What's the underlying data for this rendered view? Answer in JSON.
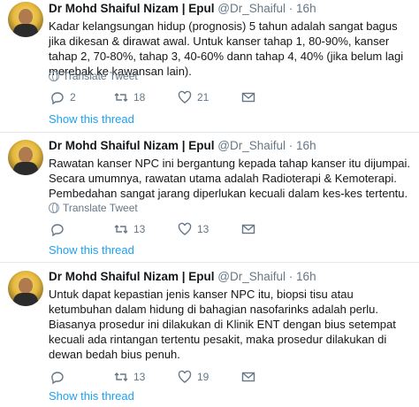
{
  "tweets": [
    {
      "name": "Dr Mohd Shaiful Nizam | Epul",
      "handle": "@Dr_Shaiful",
      "time": "16h",
      "text": "Kadar kelangsungan hidup (prognosis) 5 tahun adalah sangat bagus jika dikesan & dirawat awal. Untuk kanser tahap 1, 80-90%, kanser tahap 2, 70-80%, tahap 3, 40-60% dann tahap 4, 40% (jika belum lagi merebak ke kawansan lain).",
      "translate": "Translate Tweet",
      "replies": "2",
      "retweets": "18",
      "likes": "21",
      "show_thread": "Show this thread"
    },
    {
      "name": "Dr Mohd Shaiful Nizam | Epul",
      "handle": "@Dr_Shaiful",
      "time": "16h",
      "text": "Rawatan kanser NPC ini bergantung kepada tahap kanser itu dijumpai. Secara umumnya, rawatan utama adalah Radioterapi & Kemoterapi. Pembedahan sangat jarang diperlukan kecuali dalam kes-kes tertentu.",
      "translate": "Translate Tweet",
      "replies": "",
      "retweets": "13",
      "likes": "13",
      "show_thread": "Show this thread"
    },
    {
      "name": "Dr Mohd Shaiful Nizam | Epul",
      "handle": "@Dr_Shaiful",
      "time": "16h",
      "text": "Untuk dapat kepastian jenis kanser NPC itu, biopsi tisu atau ketumbuhan dalam hidung di bahagian nasofarinks adalah perlu. Biasanya prosedur ini dilakukan di Klinik ENT dengan bius setempat kecuali ada rintangan tertentu pesakit, maka prosedur dilakukan di dewan bedah bius penuh.",
      "translate": "",
      "replies": "",
      "retweets": "13",
      "likes": "19",
      "show_thread": "Show this thread"
    }
  ]
}
